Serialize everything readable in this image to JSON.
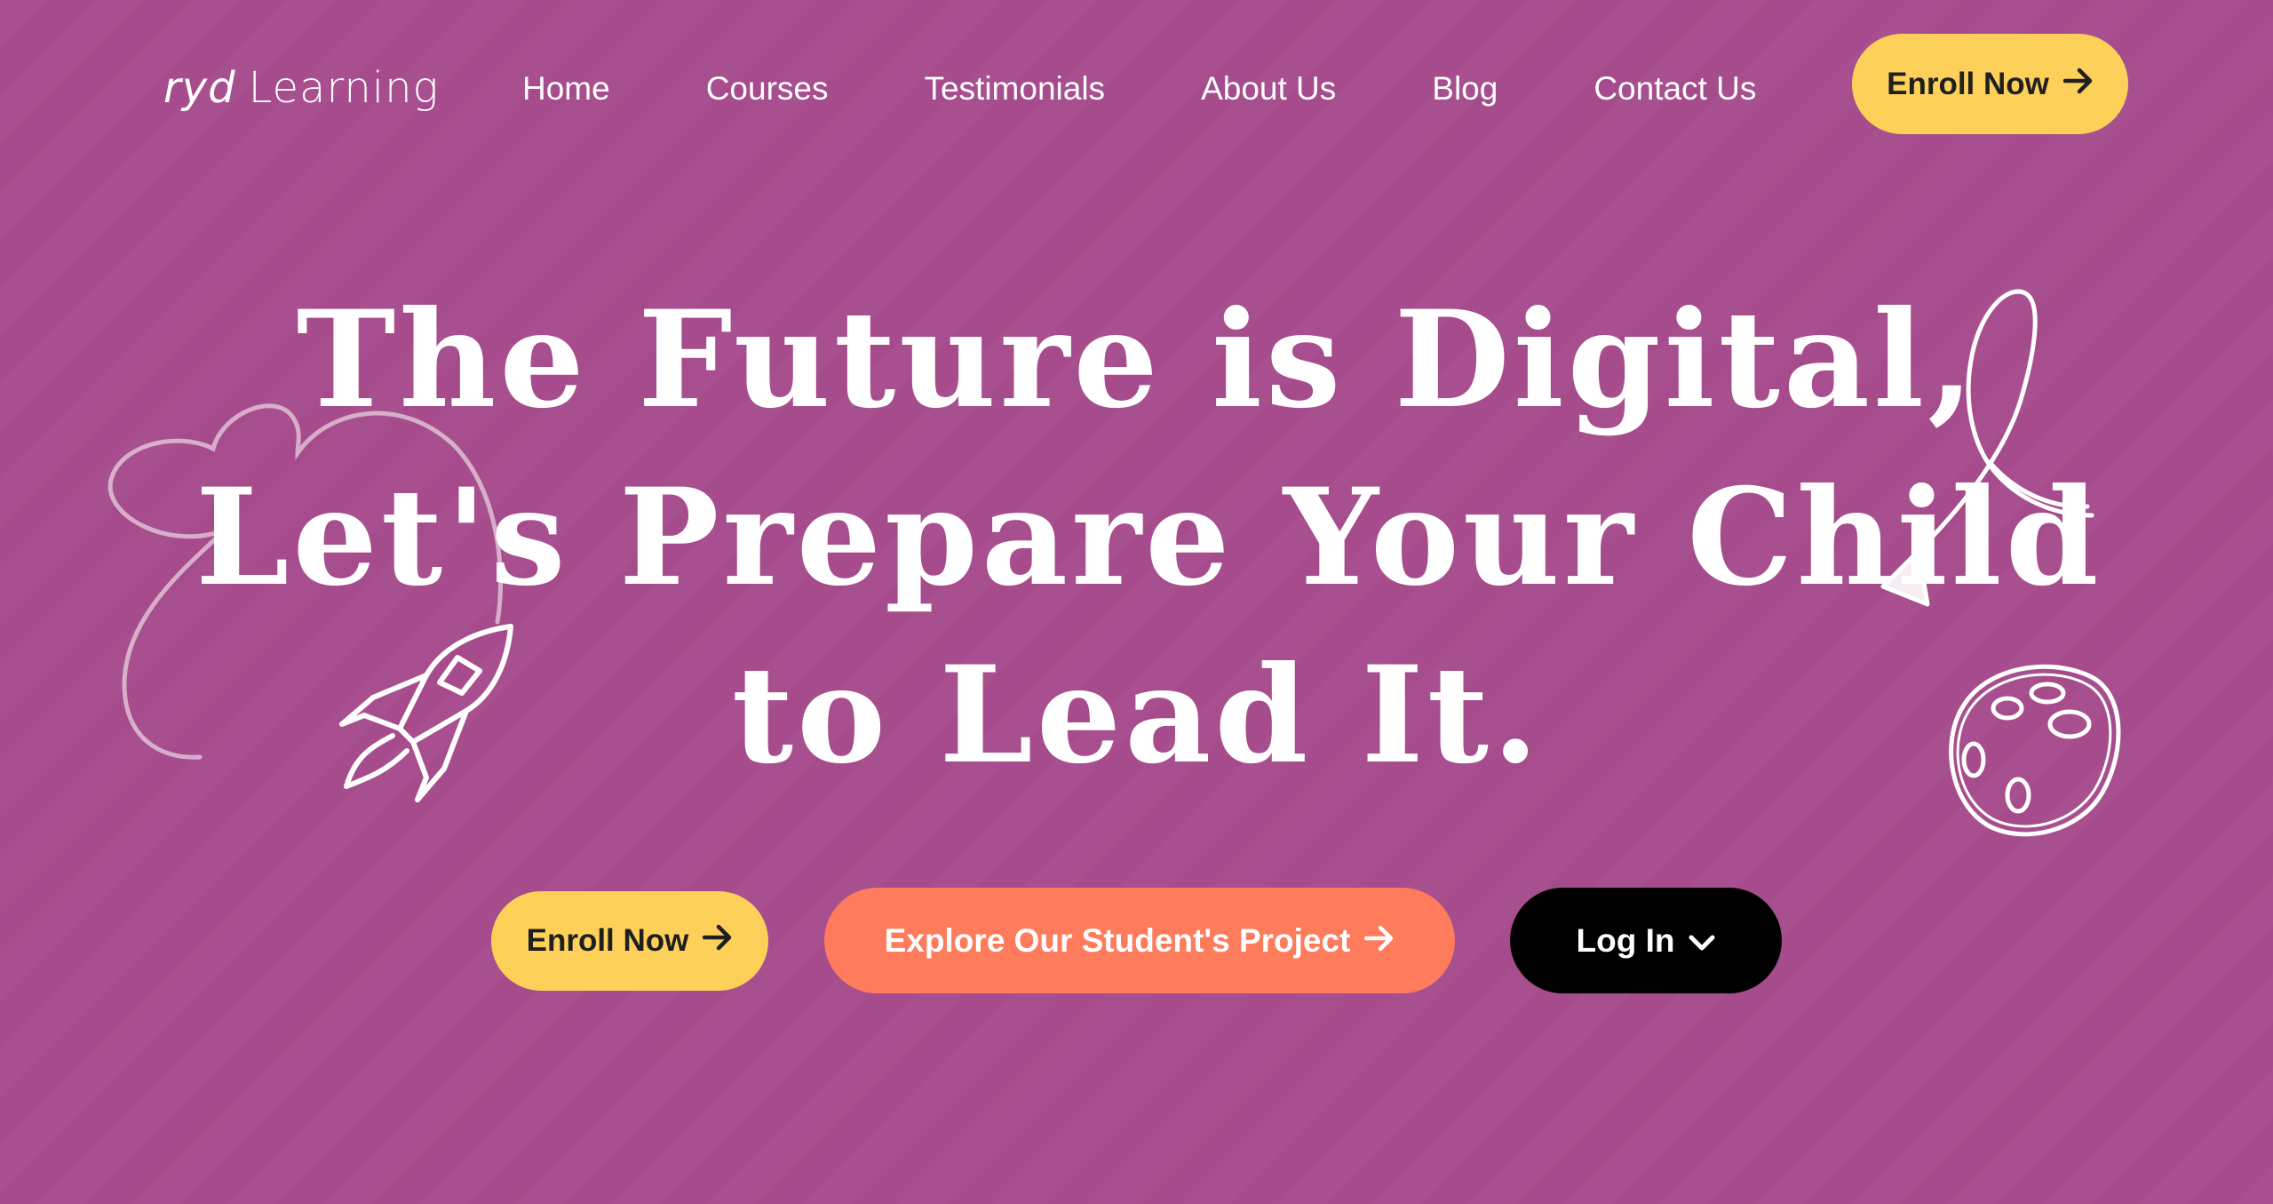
{
  "header": {
    "logo": {
      "mark": "ryd",
      "word": "Learning"
    },
    "nav": [
      {
        "label": "Home"
      },
      {
        "label": "Courses"
      },
      {
        "label": "Testimonials"
      },
      {
        "label": "About Us"
      },
      {
        "label": "Blog"
      },
      {
        "label": "Contact Us"
      }
    ],
    "cta": {
      "label": "Enroll Now",
      "icon": "arrow-right-icon"
    }
  },
  "hero": {
    "title_lines": [
      "The Future is Digital,",
      "Let's Prepare Your Child",
      "to Lead It."
    ],
    "buttons": {
      "enroll": {
        "label": "Enroll Now",
        "icon": "arrow-right-icon"
      },
      "explore": {
        "label": "Explore Our Student's Project",
        "icon": "arrow-right-icon"
      },
      "login": {
        "label": "Log In",
        "icon": "chevron-down-icon"
      }
    },
    "doodles": [
      "cloud-doodle-icon",
      "rocket-doodle-icon",
      "ribbon-arrow-doodle-icon",
      "planet-doodle-icon"
    ]
  },
  "colors": {
    "background": "#a64b8c",
    "primary_button": "#fdd05a",
    "secondary_button": "#fe7b5c",
    "login_button": "#000000",
    "text": "#ffffff"
  }
}
